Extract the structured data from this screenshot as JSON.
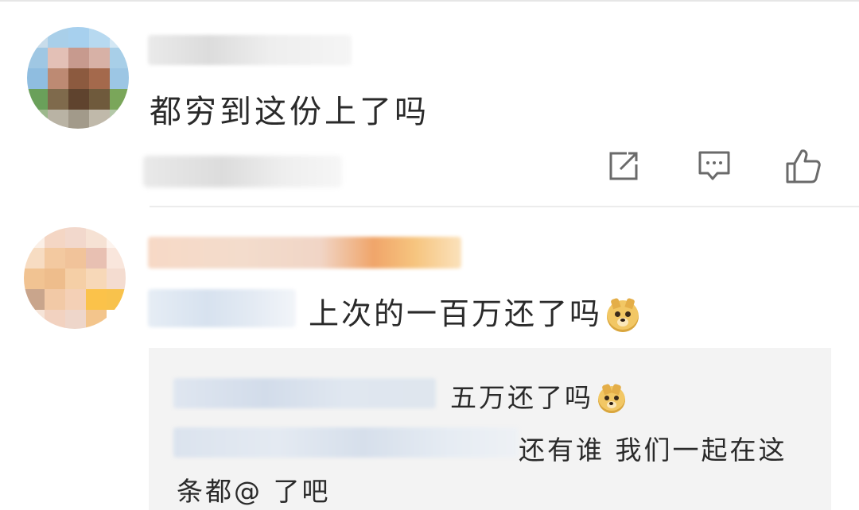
{
  "comments": [
    {
      "text": "都穷到这份上了吗",
      "actions": {
        "share_icon": "share-icon",
        "comment_icon": "comment-icon",
        "like_icon": "thumbs-up-icon"
      }
    },
    {
      "text": "上次的一百万还了吗",
      "emoji": "doge-emoji",
      "replies": [
        {
          "text": "五万还了吗",
          "emoji": "doge-emoji"
        },
        {
          "text_line1": "还有谁 我们一起在这",
          "text_line2": "条都@ 了吧"
        }
      ]
    }
  ],
  "colors": {
    "icon": "#6a6a6a",
    "text": "#2a2a2a",
    "reply_background": "#f3f3f3",
    "divider": "#ececec"
  }
}
